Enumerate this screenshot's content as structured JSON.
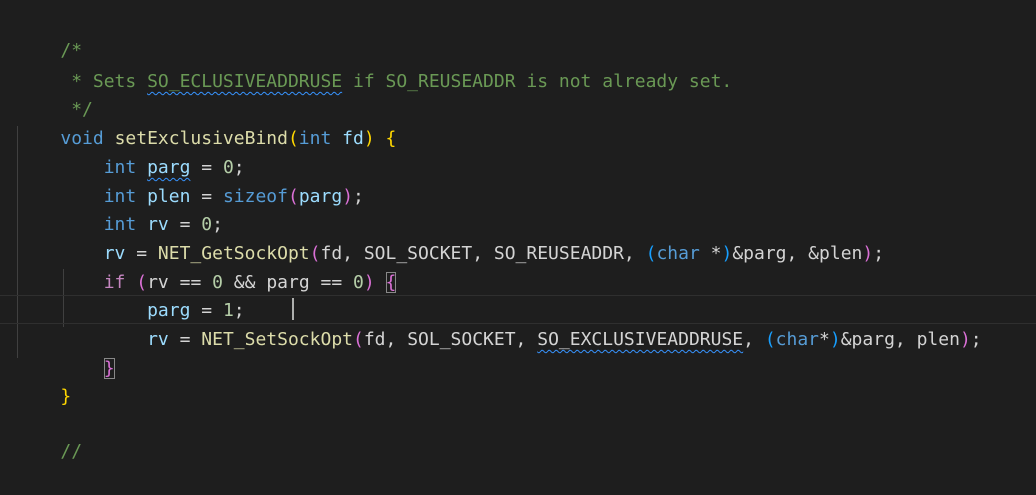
{
  "editor": {
    "colors": {
      "background": "#1e1e1e",
      "comment": "#6a9955",
      "keyword": "#569cd6",
      "control": "#c586c0",
      "function": "#dcdcaa",
      "number": "#b5cea8",
      "variable": "#9cdcfe",
      "bracket_level1": "#ffd700",
      "bracket_level2": "#da70d6",
      "bracket_level3": "#179fff"
    },
    "lines": {
      "l1": {
        "text": "/*"
      },
      "l2": {
        "prefix": " * Sets ",
        "word1": "SO_ECLUSIVEADDRUSE",
        "middle": " if SO_REUSEADDR is not already set."
      },
      "l3": {
        "text": " */"
      },
      "l4": {
        "kw_void": "void",
        "fn_name": "setExclusiveBind",
        "open_paren": "(",
        "kw_int": "int",
        "param": "fd",
        "close_paren": ")",
        "open_brace": "{"
      },
      "l5": {
        "indent": "    ",
        "kw": "int",
        "var": "parg",
        "op": " = ",
        "num": "0",
        "end": ";"
      },
      "l6": {
        "indent": "    ",
        "kw": "int",
        "var": "plen",
        "op": " = ",
        "fn": "sizeof",
        "open": "(",
        "arg": "parg",
        "close": ")",
        "end": ";"
      },
      "l7": {
        "indent": "    ",
        "kw": "int",
        "var": "rv",
        "op": " = ",
        "num": "0",
        "end": ";"
      },
      "l8": {
        "indent": "    ",
        "var": "rv",
        "op": " = ",
        "fn": "NET_GetSockOpt",
        "open": "(",
        "args1": "fd, SOL_SOCKET, SO_REUSEADDR, ",
        "cast_open": "(",
        "cast_kw": "char",
        "cast_rest": " *",
        "cast_close": ")",
        "args2": "&parg, &plen",
        "close": ")",
        "end": ";"
      },
      "l9": {
        "indent": "    ",
        "kw_if": "if",
        "open": "(",
        "cond1": "rv == ",
        "num1": "0",
        "cond2": " && parg == ",
        "num2": "0",
        "close": ")",
        "brace": "{"
      },
      "l10": {
        "indent": "        ",
        "var": "parg",
        "op": " = ",
        "num": "1",
        "end": ";"
      },
      "l11": {
        "indent": "        ",
        "var": "rv",
        "op": " = ",
        "fn_a": "NET_SetSock",
        "fn_b": "Opt",
        "open": "(",
        "args1": "fd, SOL_SOCKET, ",
        "word": "SO_EXCLUSIVEADDRUSE",
        "args2": ", ",
        "cast_open": "(",
        "cast_kw": "char",
        "cast_rest": "*",
        "cast_close": ")",
        "args3": "&parg, plen",
        "close": ")",
        "end": ";"
      },
      "l12": {
        "indent": "    ",
        "brace": "}"
      },
      "l13": {
        "brace": "}"
      },
      "l15": {
        "text": "//"
      }
    }
  }
}
